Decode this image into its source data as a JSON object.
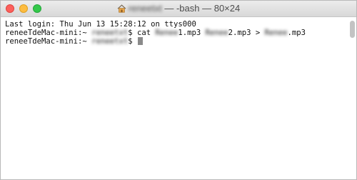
{
  "window": {
    "title": {
      "user": "reneetxt",
      "rest": " — -bash — 80×24"
    },
    "icons": {
      "close": "close-dot",
      "minimize": "minimize-dot",
      "zoom": "zoom-dot",
      "home": "home-icon"
    },
    "colors": {
      "close": "#fc605c",
      "minimize": "#fdbc40",
      "zoom": "#34c84a"
    }
  },
  "terminal": {
    "login_line": "Last login: Thu Jun 13 15:28:12 on ttys000",
    "prompt_host": "reneeTdeMac-mini:~ ",
    "prompt_user": "reneetxt",
    "prompt_symbol": "$ ",
    "command": {
      "cat": "cat ",
      "file1_name": "Renee",
      "file1_ext": "1.mp3 ",
      "file2_name": "Renee",
      "file2_ext": "2.mp3 ",
      "redirect": "> ",
      "out_name": "Renee",
      "out_ext": ".mp3"
    }
  }
}
